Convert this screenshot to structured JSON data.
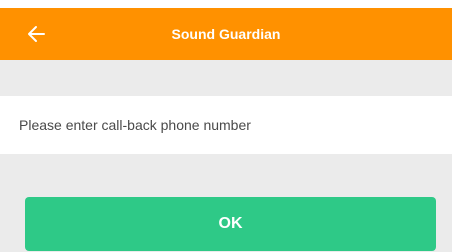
{
  "header": {
    "title": "Sound Guardian",
    "back_icon": "arrow-left-icon"
  },
  "form": {
    "phone_placeholder": "Please enter call-back phone number",
    "phone_value": ""
  },
  "actions": {
    "ok_label": "OK"
  },
  "colors": {
    "app_bar": "#ff9100",
    "background": "#ebebeb",
    "ok_button": "#2ec987"
  }
}
